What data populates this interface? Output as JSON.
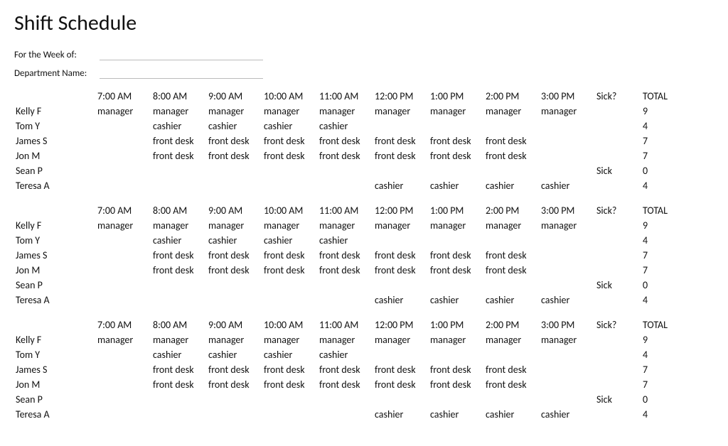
{
  "title": "Shift Schedule",
  "meta": {
    "week_label": "For the Week of:",
    "week_value": "",
    "dept_label": "Department Name:",
    "dept_value": ""
  },
  "headers": {
    "times": [
      "7:00 AM",
      "8:00 AM",
      "9:00 AM",
      "10:00 AM",
      "11:00 AM",
      "12:00 PM",
      "1:00 PM",
      "2:00 PM",
      "3:00 PM"
    ],
    "sick": "Sick?",
    "total": "TOTAL"
  },
  "blocks": [
    {
      "rows": [
        {
          "name": "Kelly F",
          "slots": [
            "manager",
            "manager",
            "manager",
            "manager",
            "manager",
            "manager",
            "manager",
            "manager",
            "manager"
          ],
          "sick": "",
          "total": "9"
        },
        {
          "name": "Tom Y",
          "slots": [
            "",
            "cashier",
            "cashier",
            "cashier",
            "cashier",
            "",
            "",
            "",
            ""
          ],
          "sick": "",
          "total": "4"
        },
        {
          "name": "James S",
          "slots": [
            "",
            "front desk",
            "front desk",
            "front desk",
            "front desk",
            "front desk",
            "front desk",
            "front desk",
            ""
          ],
          "sick": "",
          "total": "7"
        },
        {
          "name": "Jon M",
          "slots": [
            "",
            "front desk",
            "front desk",
            "front desk",
            "front desk",
            "front desk",
            "front desk",
            "front desk",
            ""
          ],
          "sick": "",
          "total": "7"
        },
        {
          "name": "Sean P",
          "slots": [
            "",
            "",
            "",
            "",
            "",
            "",
            "",
            "",
            ""
          ],
          "sick": "Sick",
          "total": "0"
        },
        {
          "name": "Teresa A",
          "slots": [
            "",
            "",
            "",
            "",
            "",
            "cashier",
            "cashier",
            "cashier",
            "cashier"
          ],
          "sick": "",
          "total": "4"
        }
      ]
    },
    {
      "rows": [
        {
          "name": "Kelly F",
          "slots": [
            "manager",
            "manager",
            "manager",
            "manager",
            "manager",
            "manager",
            "manager",
            "manager",
            "manager"
          ],
          "sick": "",
          "total": "9"
        },
        {
          "name": "Tom Y",
          "slots": [
            "",
            "cashier",
            "cashier",
            "cashier",
            "cashier",
            "",
            "",
            "",
            ""
          ],
          "sick": "",
          "total": "4"
        },
        {
          "name": "James S",
          "slots": [
            "",
            "front desk",
            "front desk",
            "front desk",
            "front desk",
            "front desk",
            "front desk",
            "front desk",
            ""
          ],
          "sick": "",
          "total": "7"
        },
        {
          "name": "Jon M",
          "slots": [
            "",
            "front desk",
            "front desk",
            "front desk",
            "front desk",
            "front desk",
            "front desk",
            "front desk",
            ""
          ],
          "sick": "",
          "total": "7"
        },
        {
          "name": "Sean P",
          "slots": [
            "",
            "",
            "",
            "",
            "",
            "",
            "",
            "",
            ""
          ],
          "sick": "Sick",
          "total": "0"
        },
        {
          "name": "Teresa A",
          "slots": [
            "",
            "",
            "",
            "",
            "",
            "cashier",
            "cashier",
            "cashier",
            "cashier"
          ],
          "sick": "",
          "total": "4"
        }
      ]
    },
    {
      "rows": [
        {
          "name": "Kelly F",
          "slots": [
            "manager",
            "manager",
            "manager",
            "manager",
            "manager",
            "manager",
            "manager",
            "manager",
            "manager"
          ],
          "sick": "",
          "total": "9"
        },
        {
          "name": "Tom Y",
          "slots": [
            "",
            "cashier",
            "cashier",
            "cashier",
            "cashier",
            "",
            "",
            "",
            ""
          ],
          "sick": "",
          "total": "4"
        },
        {
          "name": "James S",
          "slots": [
            "",
            "front desk",
            "front desk",
            "front desk",
            "front desk",
            "front desk",
            "front desk",
            "front desk",
            ""
          ],
          "sick": "",
          "total": "7"
        },
        {
          "name": "Jon M",
          "slots": [
            "",
            "front desk",
            "front desk",
            "front desk",
            "front desk",
            "front desk",
            "front desk",
            "front desk",
            ""
          ],
          "sick": "",
          "total": "7"
        },
        {
          "name": "Sean P",
          "slots": [
            "",
            "",
            "",
            "",
            "",
            "",
            "",
            "",
            ""
          ],
          "sick": "Sick",
          "total": "0"
        },
        {
          "name": "Teresa A",
          "slots": [
            "",
            "",
            "",
            "",
            "",
            "cashier",
            "cashier",
            "cashier",
            "cashier"
          ],
          "sick": "",
          "total": "4"
        }
      ]
    }
  ]
}
